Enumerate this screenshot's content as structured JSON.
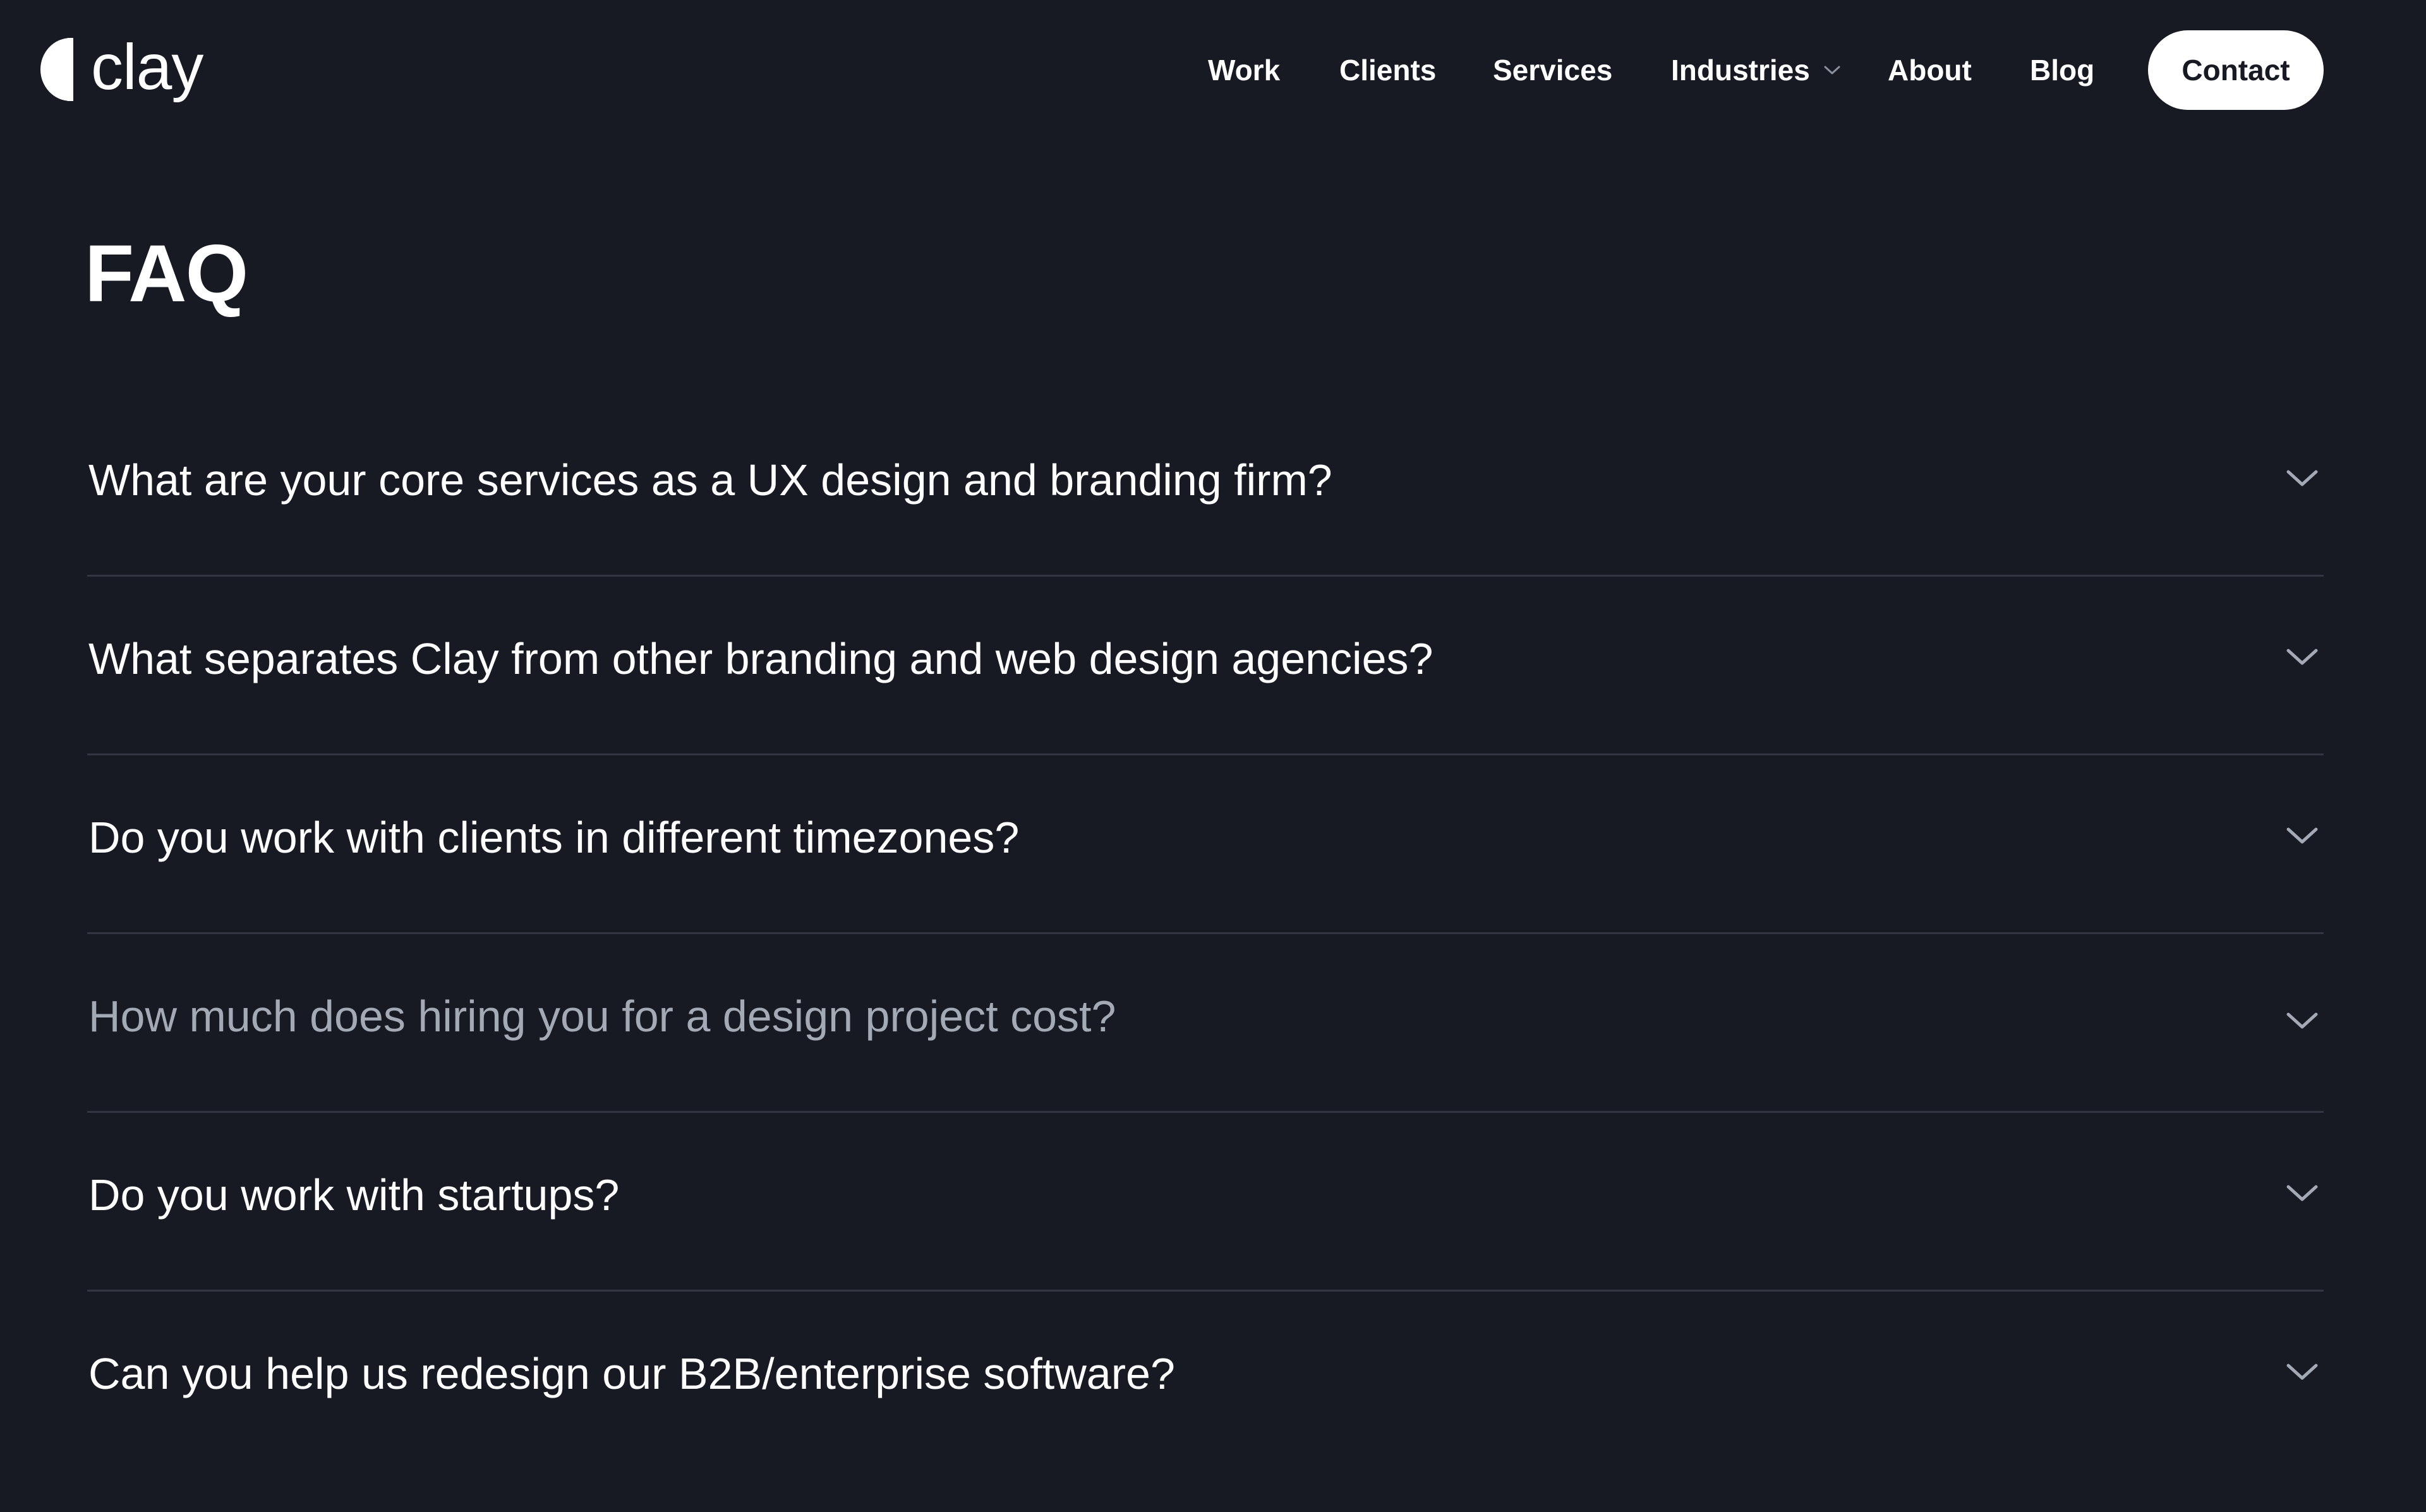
{
  "brand": {
    "name": "clay"
  },
  "nav": {
    "items": [
      {
        "label": "Work"
      },
      {
        "label": "Clients"
      },
      {
        "label": "Services"
      },
      {
        "label": "Industries",
        "has_dropdown": true
      },
      {
        "label": "About"
      },
      {
        "label": "Blog"
      }
    ],
    "contact_label": "Contact"
  },
  "faq": {
    "title": "FAQ",
    "items": [
      {
        "question": "What are your core services as a UX design and branding firm?"
      },
      {
        "question": "What separates Clay from other branding and web design agencies?"
      },
      {
        "question": "Do you work with clients in different timezones?"
      },
      {
        "question": "How much does hiring you for a design project cost?",
        "state": "hover"
      },
      {
        "question": "Do you work with startups?"
      },
      {
        "question": "Can you help us redesign our B2B/enterprise software?"
      }
    ]
  },
  "colors": {
    "background": "#171a23",
    "text": "#ffffff",
    "muted_text": "#a4a9b6",
    "divider": "#323642",
    "button_bg": "#ffffff",
    "button_text": "#171a23"
  },
  "icons": {
    "logo_mark": "half-circle-icon",
    "dropdown": "chevron-down-icon",
    "accordion": "chevron-down-icon"
  }
}
